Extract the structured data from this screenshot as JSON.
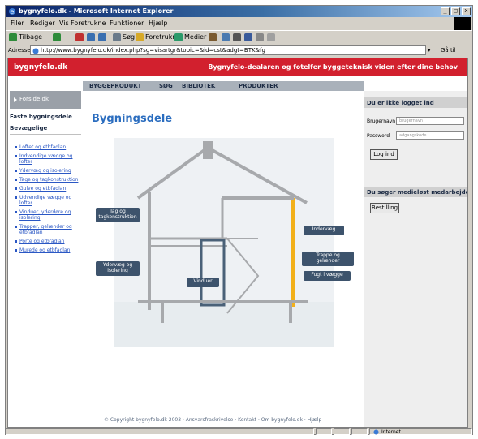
{
  "window": {
    "title": "bygnyfelo.dk - Microsoft Internet Explorer"
  },
  "menu": [
    "Filer",
    "Rediger",
    "Vis",
    "Foretrukne",
    "Funktioner",
    "Hjælp"
  ],
  "toolbar": {
    "back": "Tilbage",
    "search": "Søg",
    "favorites": "Foretrukne",
    "media": "Medier"
  },
  "address": {
    "label": "Adresse",
    "url": "http://www.bygnyfelo.dk/index.php?sg=visartgr&topic=&id=cst&adgt=BTK&fg",
    "go": "Gå til"
  },
  "site": {
    "logo": "bygnyfelo.dk",
    "tagline": "Bygnyfelo-dealaren og fotelfer byggeteknisk viden efter dine behov"
  },
  "nav": {
    "tabs": [
      "BYGGEPRODUKT",
      "SØG",
      "BIBLIOTEK",
      "PRODUKTER"
    ]
  },
  "sidebar": {
    "top_item": "Forside dk",
    "headings": [
      "Faste bygningsdele",
      "Bevægelige"
    ],
    "links": [
      "Loftet og etbfadlan",
      "Indvendige vægge og lofter",
      "Ydervæg og isolering",
      "Tage og tagkonstruktion",
      "Gulve og etbfadlan",
      "Udvendige vægge og lofter",
      "Vinduer, yderdøre og isolering",
      "Trapper, gelænder og etbfadlan",
      "Porte og etbfadlan",
      "Murede og etbfadlan"
    ]
  },
  "main": {
    "title": "Bygningsdele",
    "callouts": [
      "Tag og tagkonstruktion",
      "Ydervæg og isolering",
      "Vinduer",
      "Indervæg",
      "Trappe og gelænder",
      "Fugt i vægge"
    ],
    "footer": "© Copyright bygnyfelo.dk 2003 · Ansvarsfraskrivelse · Kontakt · Om bygnyfelo.dk · Hjælp"
  },
  "login": {
    "heading": "Du er ikke logget ind",
    "username_label": "Brugernavn",
    "username_placeholder": "brugernavn",
    "password_label": "Password",
    "password_placeholder": "adgangskode",
    "button": "Log ind"
  },
  "signup": {
    "heading": "Du søger medieløst medarbejdet",
    "button": "Bestilling"
  },
  "status": {
    "zone": "Internet"
  },
  "colors": {
    "brand_red": "#d2202e",
    "nav_blue": "#1c2b44",
    "title_blue": "#2b6dbf",
    "callout": "#3d536c",
    "accent_yellow": "#f2b019"
  }
}
